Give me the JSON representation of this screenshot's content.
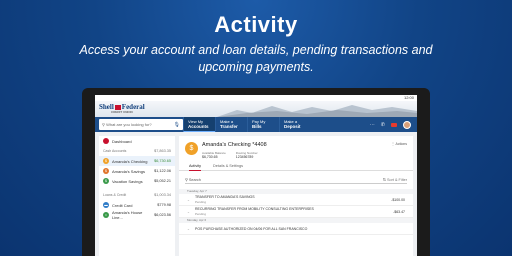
{
  "promo": {
    "headline": "Activity",
    "subhead": "Access your account and loan details, pending transactions and upcoming payments."
  },
  "status": {
    "time": "12:00"
  },
  "brand": {
    "logo_left": "Shell",
    "logo_right": "Federal",
    "tagline": "CREDIT UNION"
  },
  "nav": {
    "search_placeholder": "What are you looking for?",
    "buttons": [
      {
        "top": "View My",
        "bottom": "Accounts"
      },
      {
        "top": "Make a",
        "bottom": "Transfer"
      },
      {
        "top": "Pay My",
        "bottom": "Bills"
      },
      {
        "top": "Make a",
        "bottom": "Deposit"
      }
    ]
  },
  "sidebar": {
    "dashboard": "Dashboard",
    "cash_label": "Cash Accounts",
    "cash_total": "$7,863.35",
    "accounts": [
      {
        "name": "Amanda's Checking",
        "amount": "$6,730.65",
        "color": "#f0a128"
      },
      {
        "name": "Amanda's Savings",
        "amount": "$1,122.06",
        "color": "#e0742a"
      },
      {
        "name": "Vacation Savings",
        "amount": "$5,052.21",
        "color": "#3a9a4a"
      }
    ],
    "loans_label": "Loans & Credit",
    "loans_total": "$1,003.34",
    "loans": [
      {
        "name": "Credit Card",
        "amount": "$779.98",
        "color": "#2f7cc7"
      },
      {
        "name": "Amanda's House Line...",
        "amount": "$6,023.56",
        "color": "#3a9a4a"
      }
    ]
  },
  "account": {
    "title": "Amanda's Checking *4408",
    "available_label": "Available Balance",
    "available_value": "$6,730.65",
    "routing_label": "Routing Number",
    "routing_value": "123456789",
    "actions": "Actions",
    "tabs": [
      "Activity",
      "Details & Settings"
    ],
    "search_label": "Search",
    "filter_label": "Sort & Filter"
  },
  "transactions": [
    {
      "date": "Tuesday, Apr 7"
    },
    {
      "desc": "TRANSFER TO AMANDA'S SAVINGS",
      "status": "Pending",
      "amount": "-$100.00"
    },
    {
      "desc": "RECURRING TRANSFER FROM MOBILITY CONSULTING ENTERPRISES",
      "status": "Pending",
      "amount": "-$63.47"
    },
    {
      "date": "Monday, Apr 6"
    },
    {
      "desc": "POS PURCHASE AUTHORIZED ON 04/06 FOR ALL SAN FRANCISCO",
      "status": "",
      "amount": ""
    }
  ],
  "colors": {
    "navy": "#1d4e8a",
    "background": "#114486",
    "accent_orange": "#f0a128"
  }
}
